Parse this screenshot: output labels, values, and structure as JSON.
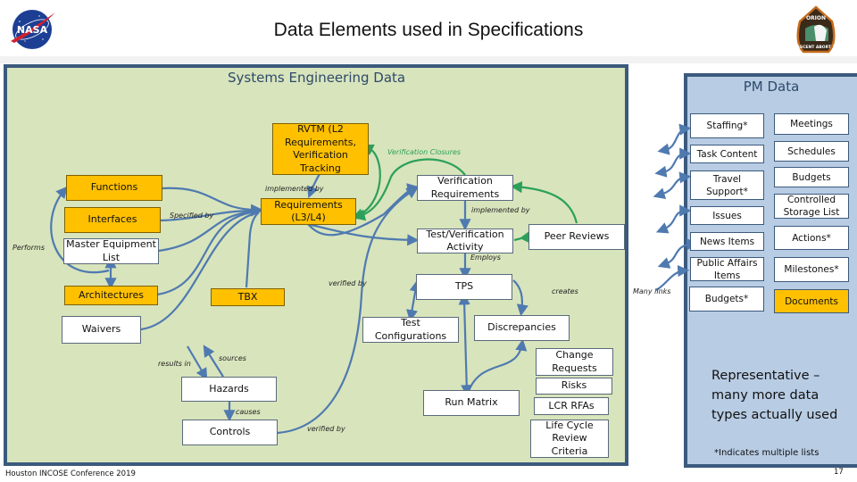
{
  "header": {
    "title": "Data Elements used in Specifications",
    "left_logo": "nasa-meatball-logo",
    "right_logo": "orion-ascent-abort-2-patch",
    "right_logo_text": [
      "ORION",
      "ASCENT ABORT 2"
    ]
  },
  "se_panel": {
    "title": "Systems Engineering Data",
    "nodes": {
      "rvtm": "RVTM (L2 Requirements, Verification Tracking",
      "functions": "Functions",
      "interfaces": "Interfaces",
      "mel": "Master Equipment List",
      "architectures": "Architectures",
      "requirements": "Requirements (L3/L4)",
      "tbx": "TBX",
      "waivers": "Waivers",
      "hazards": "Hazards",
      "controls": "Controls",
      "verif_req": "Verification Requirements",
      "test_verif": "Test/Verification Activity",
      "peer_reviews": "Peer Reviews",
      "tps": "TPS",
      "test_config": "Test Configurations",
      "discrepancies": "Discrepancies",
      "run_matrix": "Run Matrix",
      "change_requests": "Change Requests",
      "risks": "Risks",
      "lcr_rfas": "LCR RFAs",
      "lcrc": "Life Cycle Review Criteria"
    },
    "edge_labels": {
      "implemented_by_1": "implemented by",
      "specified_by": "Specified by",
      "performs": "Performs",
      "verification_closures": "Verification Closures",
      "implemented_by_2": "implemented by",
      "employs": "Employs",
      "verified_by_1": "verified by",
      "creates": "creates",
      "results_in": "results in",
      "sources": "sources",
      "causes": "causes",
      "verified_by_2": "verified by",
      "many_links": "Many links"
    }
  },
  "pm_panel": {
    "title": "PM Data",
    "left_column": [
      "Staffing*",
      "Task Content",
      "Travel Support*",
      "Issues",
      "News Items",
      "Public Affairs Items",
      "Budgets*"
    ],
    "right_column": [
      "Meetings",
      "Schedules",
      "Budgets",
      "Controlled Storage List",
      "Actions*",
      "Milestones*",
      "Documents"
    ],
    "note": "Representative – many more data types actually used",
    "footnote": "*Indicates multiple lists"
  },
  "footer": {
    "conference": "Houston INCOSE Conference 2019",
    "slide_number": "17"
  },
  "colors": {
    "se_background": "#d8e4bc",
    "pm_background": "#b8cce4",
    "panel_border": "#3b5a7d",
    "orange_node": "#ffc000",
    "blue_arrow": "#4f7ab0",
    "green_arrow": "#2ca05a"
  }
}
